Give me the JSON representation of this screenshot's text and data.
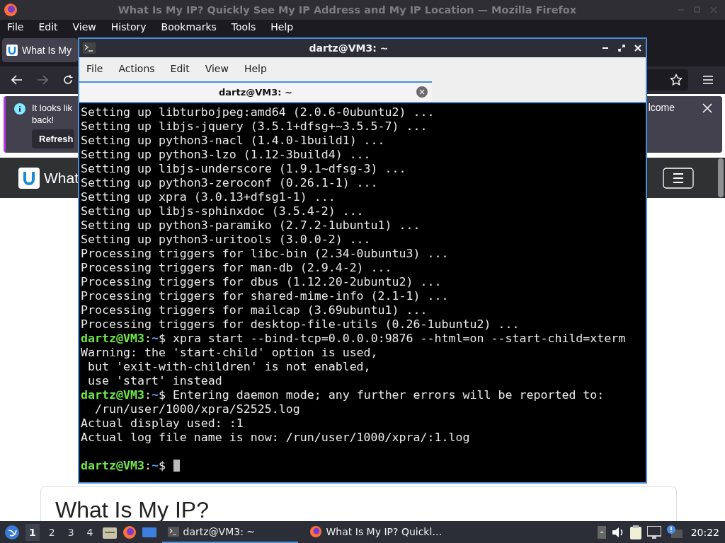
{
  "browser": {
    "title": "What Is My IP? Quickly See My IP Address and My IP Location — Mozilla Firefox",
    "menu": [
      "File",
      "Edit",
      "View",
      "History",
      "Bookmarks",
      "Tools",
      "Help"
    ],
    "tab": {
      "label": "What Is My",
      "selected": true
    },
    "notification": {
      "lines": [
        "It looks lik",
        "back!"
      ],
      "button": "Refresh",
      "tail": "lcome"
    },
    "site": {
      "brand": "What",
      "heading": "What Is My IP?"
    }
  },
  "terminal": {
    "title": "dartz@VM3: ~",
    "menu": [
      "File",
      "Actions",
      "Edit",
      "View",
      "Help"
    ],
    "tab": {
      "label": "dartz@VM3: ~",
      "selected": true
    },
    "lines": [
      {
        "kind": "output",
        "text": "Setting up libturbojpeg:amd64 (2.0.6-0ubuntu2) ..."
      },
      {
        "kind": "output",
        "text": "Setting up libjs-jquery (3.5.1+dfsg+~3.5.5-7) ..."
      },
      {
        "kind": "output",
        "text": "Setting up python3-nacl (1.4.0-1build1) ..."
      },
      {
        "kind": "output",
        "text": "Setting up python3-lzo (1.12-3build4) ..."
      },
      {
        "kind": "output",
        "text": "Setting up libjs-underscore (1.9.1~dfsg-3) ..."
      },
      {
        "kind": "output",
        "text": "Setting up python3-zeroconf (0.26.1-1) ..."
      },
      {
        "kind": "output",
        "text": "Setting up xpra (3.0.13+dfsg1-1) ..."
      },
      {
        "kind": "output",
        "text": "Setting up libjs-sphinxdoc (3.5.4-2) ..."
      },
      {
        "kind": "output",
        "text": "Setting up python3-paramiko (2.7.2-1ubuntu1) ..."
      },
      {
        "kind": "output",
        "text": "Setting up python3-uritools (3.0.0-2) ..."
      },
      {
        "kind": "output",
        "text": "Processing triggers for libc-bin (2.34-0ubuntu3) ..."
      },
      {
        "kind": "output",
        "text": "Processing triggers for man-db (2.9.4-2) ..."
      },
      {
        "kind": "output",
        "text": "Processing triggers for dbus (1.12.20-2ubuntu2) ..."
      },
      {
        "kind": "output",
        "text": "Processing triggers for shared-mime-info (2.1-1) ..."
      },
      {
        "kind": "output",
        "text": "Processing triggers for mailcap (3.69ubuntu1) ..."
      },
      {
        "kind": "output",
        "text": "Processing triggers for desktop-file-utils (0.26-1ubuntu2) ..."
      },
      {
        "kind": "prompt",
        "host": "dartz@VM3",
        "separator": ":",
        "path": "~",
        "symbol": "$",
        "text": "xpra start --bind-tcp=0.0.0.0:9876 --html=on --start-child=xterm",
        "cursor": false
      },
      {
        "kind": "output",
        "text": "Warning: the 'start-child' option is used,"
      },
      {
        "kind": "output",
        "text": " but 'exit-with-children' is not enabled,"
      },
      {
        "kind": "output",
        "text": " use 'start' instead"
      },
      {
        "kind": "prompt",
        "host": "dartz@VM3",
        "separator": ":",
        "path": "~",
        "symbol": "$",
        "text": "Entering daemon mode; any further errors will be reported to:",
        "cursor": false
      },
      {
        "kind": "output",
        "text": "  /run/user/1000/xpra/S2525.log"
      },
      {
        "kind": "output",
        "text": "Actual display used: :1"
      },
      {
        "kind": "output",
        "text": "Actual log file name is now: /run/user/1000/xpra/:1.log"
      },
      {
        "kind": "blank"
      },
      {
        "kind": "prompt",
        "host": "dartz@VM3",
        "separator": ":",
        "path": "~",
        "symbol": "$",
        "cursor": true
      }
    ]
  },
  "taskbar": {
    "workspaces": [
      {
        "label": "1",
        "selected": true
      },
      {
        "label": "2",
        "selected": false
      },
      {
        "label": "3",
        "selected": false
      },
      {
        "label": "4",
        "selected": false
      }
    ],
    "tasks": [
      {
        "kind": "terminal",
        "label": "dartz@VM3: ~",
        "selected": true
      },
      {
        "kind": "browser",
        "label": "What Is My IP? Quickl…",
        "selected": false
      }
    ],
    "clock": "20:22"
  }
}
